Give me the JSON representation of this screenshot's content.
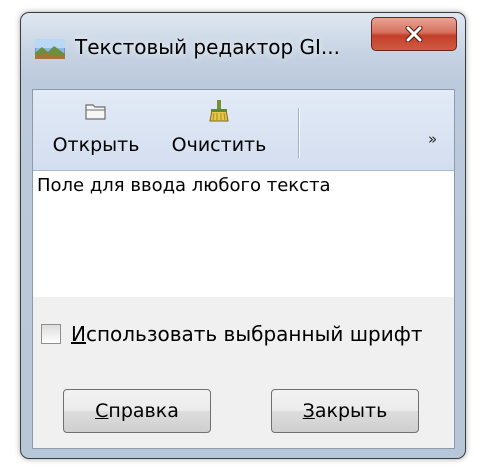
{
  "window": {
    "title": "Текстовый редактор GI..."
  },
  "toolbar": {
    "open_label": "Открыть",
    "clear_label": "Очистить",
    "overflow_label": "»"
  },
  "editor": {
    "text": "Поле для ввода любого текста"
  },
  "checkbox": {
    "mnemonic": "И",
    "label_rest": "спользовать выбранный шрифт",
    "checked": false
  },
  "buttons": {
    "help_mnemonic": "С",
    "help_rest": "правка",
    "close_mnemonic": "З",
    "close_rest": "акрыть"
  },
  "icons": {
    "app": "landscape-icon",
    "open": "folder-icon",
    "clear": "broom-icon",
    "close": "close-icon"
  },
  "colors": {
    "close_button": "#c33f2a",
    "toolbar_bg": "#dde6f4",
    "window_frame": "#c6d3e3"
  }
}
